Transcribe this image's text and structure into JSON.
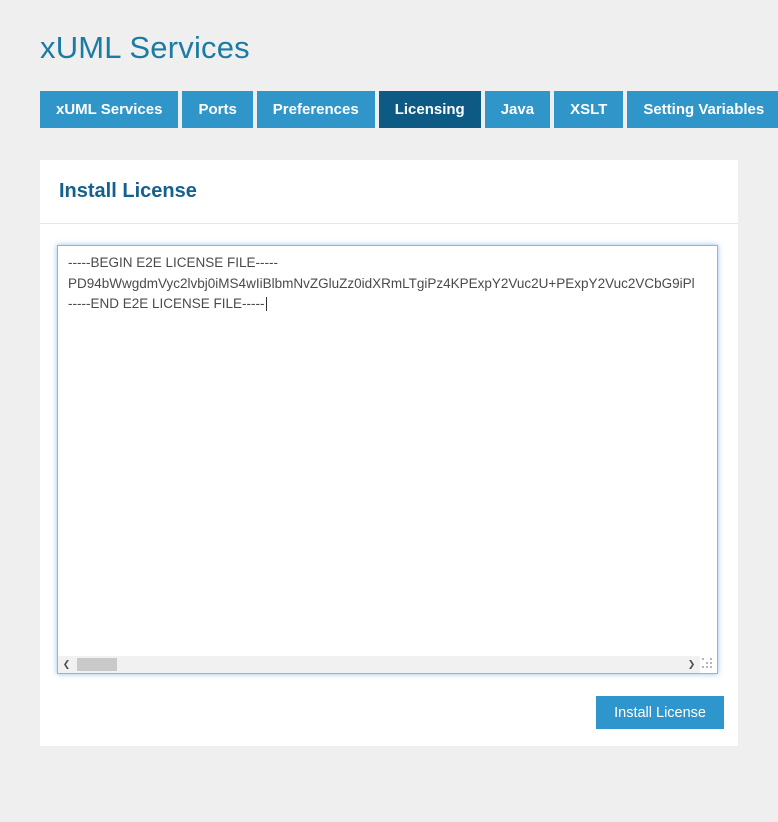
{
  "page": {
    "title": "xUML Services"
  },
  "tabs": {
    "active": "Licensing",
    "items": [
      {
        "label": "xUML Services"
      },
      {
        "label": "Ports"
      },
      {
        "label": "Preferences"
      },
      {
        "label": "Licensing"
      },
      {
        "label": "Java"
      },
      {
        "label": "XSLT"
      },
      {
        "label": "Setting Variables"
      }
    ]
  },
  "panel": {
    "heading": "Install License",
    "license": {
      "lines": [
        "-----BEGIN E2E LICENSE FILE-----",
        "PD94bWwgdmVyc2lvbj0iMS4wIiBlbmNvZGluZz0idXRmLTgiPz4KPExpY2Vuc2U+PExpY2Vuc2VCbG9iPl",
        "-----END E2E LICENSE FILE-----"
      ]
    },
    "button_label": "Install License"
  },
  "scrollbar": {
    "left_arrow": "❮",
    "right_arrow": "❯"
  },
  "colors": {
    "page_bg": "#efeff0",
    "title": "#1b7ba3",
    "tab_bg": "#3095c8",
    "tab_active_bg": "#0d5a84",
    "heading": "#14618f",
    "button_bg": "#2e96cd",
    "textarea_border": "#85bbe3"
  }
}
